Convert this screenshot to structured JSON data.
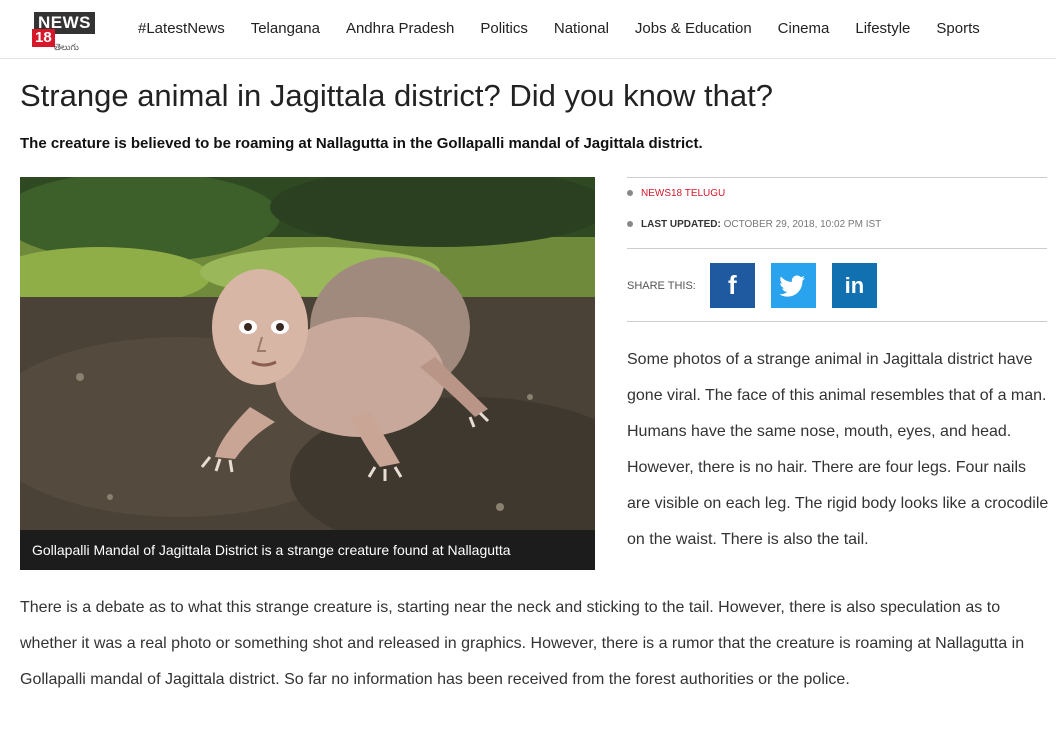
{
  "header": {
    "logo_text": "NEWS",
    "logo_number": "18",
    "logo_sub": "తెలుగు",
    "nav": [
      "#LatestNews",
      "Telangana",
      "Andhra Pradesh",
      "Politics",
      "National",
      "Jobs & Education",
      "Cinema",
      "Lifestyle",
      "Sports"
    ]
  },
  "article": {
    "title": "Strange animal in Jagittala district? Did you know that?",
    "subtitle": "The creature is believed to be roaming at Nallagutta in the Gollapalli mandal of Jagittala district.",
    "image_caption": "Gollapalli Mandal of Jagittala District is a strange creature found at Nallagutta",
    "source": "NEWS18 TELUGU",
    "updated_label": "LAST UPDATED:",
    "updated_value": "OCTOBER 29, 2018, 10:02 PM IST",
    "share_label": "SHARE THIS:",
    "share_buttons": {
      "facebook": "f",
      "twitter": "t",
      "linkedin": "in"
    },
    "paragraph_side": "Some photos of a strange animal in Jagittala district have gone viral. The face of this animal resembles that of a man. Humans have the same nose, mouth, eyes, and head. However, there is no hair. There are four legs. Four nails are visible on each leg. The rigid body looks like a crocodile on the waist. There is also the tail.",
    "paragraph_full": "There is a debate as to what this strange creature is, starting near the neck and sticking to the tail. However, there is also speculation as to whether it was a real photo or something shot and released in graphics. However, there is a rumor that the creature is roaming at Nallagutta in Gollapalli mandal of Jagittala district. So far no information has been received from the forest authorities or the police."
  },
  "colors": {
    "brand_red": "#d7182a",
    "facebook": "#1f5aa0",
    "twitter": "#2aa3ef",
    "linkedin": "#1170b0"
  }
}
